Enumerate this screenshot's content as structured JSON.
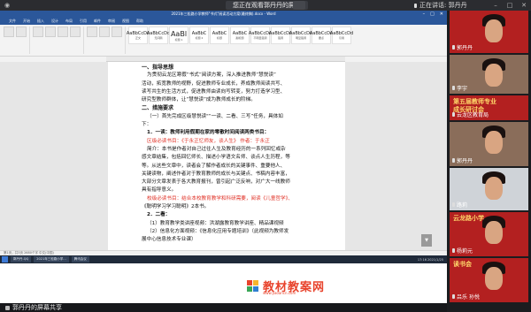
{
  "meeting": {
    "sharing_notice": "您正在观看郭丹丹的屏幕",
    "speaking_label": "正在讲话: 郭丹丹",
    "share_status": "郭丹丹的屏幕共享"
  },
  "word": {
    "title": "2021年三松路小学教师\"书式\"阅读活动方案(最终稿).docx - Word",
    "tabs": [
      "文件",
      "开始",
      "插入",
      "设计",
      "布局",
      "引用",
      "邮件",
      "审阅",
      "视图",
      "帮助"
    ],
    "styles": [
      {
        "preview": "AaBbCcDd",
        "name": "正文"
      },
      {
        "preview": "AaBbCcDd",
        "name": "无间隔"
      },
      {
        "preview": "AaBl",
        "name": "标题 1"
      },
      {
        "preview": "AaBbC",
        "name": "标题 2"
      },
      {
        "preview": "AaBbC",
        "name": "标题"
      },
      {
        "preview": "AaBbC",
        "name": "副标题"
      },
      {
        "preview": "AaBbCcDd",
        "name": "不明显强调"
      },
      {
        "preview": "AaBbCcDd",
        "name": "强调"
      },
      {
        "preview": "AaBbCcDd",
        "name": "明显强调"
      },
      {
        "preview": "AaBbCcDd",
        "name": "要点"
      },
      {
        "preview": "AaBbCcDd",
        "name": "引用"
      }
    ],
    "status_text": "第1页，共3页  2680个字  中文(中国)",
    "zoom_badge": "35",
    "zoom_badge_sub": "%"
  },
  "document": {
    "lines": [
      {
        "text": "一、指导思想",
        "cls": "sec"
      },
      {
        "text": "为贯彻云龙区寒假“书式”阅读方案，深入推进教师“慧悦读”",
        "cls": "indent"
      },
      {
        "text": "活动，拓宽教师的视野，促进教师专业成长，养成教师阅读共写、",
        "cls": ""
      },
      {
        "text": "读写共生的生活方式，促进教师由读向写转变，努力打造学习型、",
        "cls": ""
      },
      {
        "text": "研究型教师群体，让“慧悦读”成为教师成长的阶梯。",
        "cls": ""
      },
      {
        "text": "二、措施要求",
        "cls": "sec"
      },
      {
        "text": "（一）首先完成区级慧悦读\"“一读、二看、三写”任务，具体如",
        "cls": "indent"
      },
      {
        "text": "下：",
        "cls": ""
      },
      {
        "text": "1．一读：教师利用假期在家的零散时间阅读两类书目：",
        "cls": "indent bold"
      },
      {
        "text": "区级必读书目：《于永正忆师友，谈人生》  作者：于永正",
        "cls": "indent"
      },
      {
        "text": "简介：本书是作者对自己过往人生及教育经历的一系列回忆或杂",
        "cls": "indent"
      },
      {
        "text": "感文章结集，包括回忆师长、描述小学语文名师、谈点人生历程，等",
        "cls": ""
      },
      {
        "text": "等。从这些文章中，读者会了解作者成长的关键事件、重要他人、",
        "cls": ""
      },
      {
        "text": "关键读物，阐述作者对于教育教师的成长与关键点、书稿内容丰富，",
        "cls": ""
      },
      {
        "text": "大部分文章发表于各大教育报刊，曾引起广泛反响，对广大一线教师",
        "cls": ""
      },
      {
        "text": "具有指导意义。",
        "cls": ""
      },
      {
        "text": "校级必读书目：结合本校教育教学和科研需要，阅读《儿童哲学》、",
        "cls": "indent"
      },
      {
        "text": "《聪明学习学习聪明》2本书。",
        "cls": ""
      },
      {
        "text": "2．二看：",
        "cls": "indent bold"
      },
      {
        "text": "（1）教育教学类讲座视频：洪湖露教育教学讲座、精品课视频",
        "cls": "indent"
      },
      {
        "text": "（2）信息化方面视频：《信息化应用专题培训》（此视频为教师发",
        "cls": "indent"
      },
      {
        "text": "展中心信息技术专业课）",
        "cls": ""
      }
    ]
  },
  "taskbar": {
    "items": [
      "郭丹丹-QQ",
      "2021年三松路小学…",
      "腾讯会议"
    ],
    "clock": "17:16 2021/1/25"
  },
  "watermark": {
    "text": "教材教案网",
    "sub": "www.jiaoancn.com"
  },
  "participants": [
    {
      "name": "郭丹丹",
      "bg": "redwall"
    },
    {
      "name": "李宇",
      "bg": "photo"
    },
    {
      "name": "云龙区教育局",
      "bg": "redwall"
    },
    {
      "name": "郭丹丹",
      "bg": "photo"
    },
    {
      "name": "路莉",
      "bg": "photo"
    },
    {
      "name": "杨莉元",
      "bg": "redwall"
    },
    {
      "name": "吕乐 孙悦",
      "bg": "redwall"
    }
  ],
  "tile_banner_texts": [
    "第五届教师专业",
    "成长研讨会",
    "云龙路小学",
    "读书会"
  ]
}
